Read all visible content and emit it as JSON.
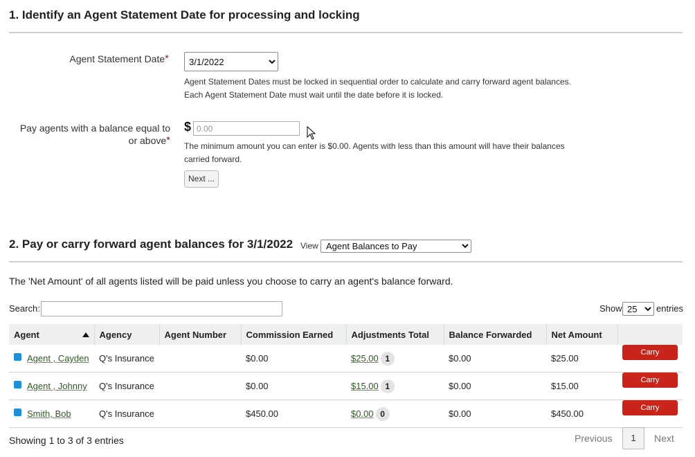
{
  "section1": {
    "title": "1. Identify an Agent Statement Date for processing and locking",
    "date_label": "Agent Statement Date",
    "date_value": "3/1/2022",
    "date_help_1": "Agent Statement Dates must be locked in sequential order to calculate and carry forward agent balances.",
    "date_help_2": "Each Agent Statement Date must wait until the date before it is locked.",
    "pay_label_1": "Pay agents with a balance equal to",
    "pay_label_2": "or above",
    "currency_symbol": "$",
    "amount_placeholder": "0.00",
    "amount_help_1": "The minimum amount you can enter is $0.00. Agents with less than this amount will have their balances",
    "amount_help_2": "carried forward.",
    "next_label": "Next ...",
    "required_mark": "*"
  },
  "section2": {
    "title": "2. Pay or carry forward agent balances for 3/1/2022",
    "view_label": "View",
    "view_value": "Agent Balances to Pay",
    "intro": "The 'Net Amount' of all agents listed will be paid unless you choose to carry an agent's balance forward.",
    "search_label": "Search:",
    "search_value": "",
    "show_label": "Show",
    "show_value": "25",
    "entries_label": "entries"
  },
  "table": {
    "columns": [
      "Agent",
      "Agency",
      "Agent Number",
      "Commission Earned",
      "Adjustments Total",
      "Balance Forwarded",
      "Net Amount",
      ""
    ],
    "rows": [
      {
        "agent": "Agent , Cayden",
        "agency": "Q's Insurance",
        "number": "",
        "commission": "$0.00",
        "adjustments": "$25.00",
        "adj_count": "1",
        "balance": "$0.00",
        "net": "$25.00",
        "action": "Carry Forward"
      },
      {
        "agent": "Agent , Johnny",
        "agency": "Q's Insurance",
        "number": "",
        "commission": "$0.00",
        "adjustments": "$15.00",
        "adj_count": "1",
        "balance": "$0.00",
        "net": "$15.00",
        "action": "Carry Forward"
      },
      {
        "agent": "Smith, Bob",
        "agency": "Q's Insurance",
        "number": "",
        "commission": "$450.00",
        "adjustments": "$0.00",
        "adj_count": "0",
        "balance": "$0.00",
        "net": "$450.00",
        "action": "Carry Forward"
      }
    ]
  },
  "footer": {
    "showing": "Showing 1 to 3 of 3 entries",
    "previous": "Previous",
    "page": "1",
    "next": "Next"
  },
  "colors": {
    "carry_forward_button": "#c8241b",
    "agent_marker": "#1e8fd6",
    "link": "#2d5b22"
  }
}
